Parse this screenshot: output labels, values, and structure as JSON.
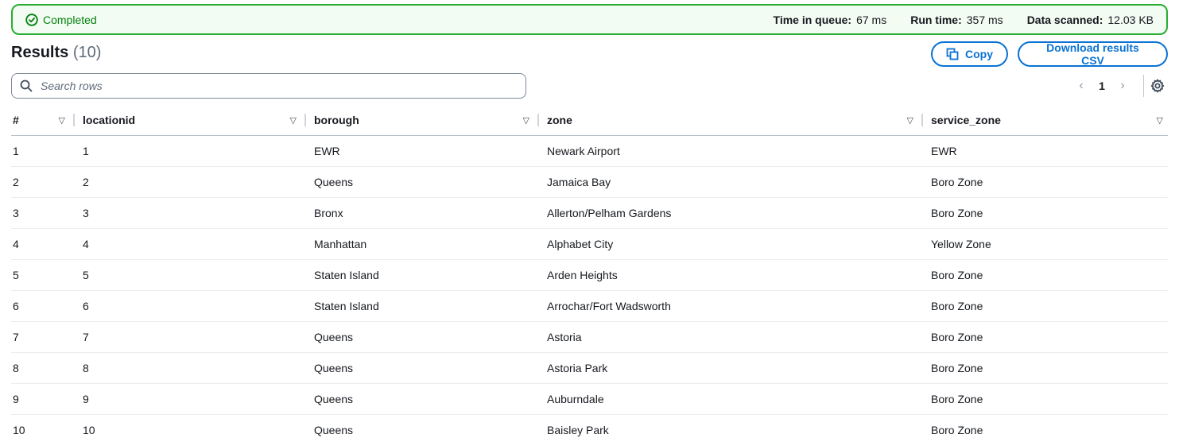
{
  "status": {
    "label": "Completed",
    "metrics": [
      {
        "name": "Time in queue:",
        "value": "67 ms"
      },
      {
        "name": "Run time:",
        "value": "357 ms"
      },
      {
        "name": "Data scanned:",
        "value": "12.03 KB"
      }
    ]
  },
  "results": {
    "title": "Results",
    "count": "(10)"
  },
  "actions": {
    "copy_label": "Copy",
    "download_label": "Download results CSV"
  },
  "search": {
    "placeholder": "Search rows",
    "value": ""
  },
  "pagination": {
    "prev": "‹",
    "page": "1",
    "next": "›"
  },
  "icons": {
    "status": "check-circle-icon",
    "copy": "copy-icon",
    "search": "search-icon",
    "sort": "sort-triangle-icon",
    "settings": "gear-icon"
  },
  "colors": {
    "success": "#037f0c",
    "success_border": "#29ad32",
    "accent": "#0972d3"
  },
  "table": {
    "columns": [
      "#",
      "locationid",
      "borough",
      "zone",
      "service_zone"
    ],
    "rows": [
      [
        "1",
        "1",
        "EWR",
        "Newark Airport",
        "EWR"
      ],
      [
        "2",
        "2",
        "Queens",
        "Jamaica Bay",
        "Boro Zone"
      ],
      [
        "3",
        "3",
        "Bronx",
        "Allerton/Pelham Gardens",
        "Boro Zone"
      ],
      [
        "4",
        "4",
        "Manhattan",
        "Alphabet City",
        "Yellow Zone"
      ],
      [
        "5",
        "5",
        "Staten Island",
        "Arden Heights",
        "Boro Zone"
      ],
      [
        "6",
        "6",
        "Staten Island",
        "Arrochar/Fort Wadsworth",
        "Boro Zone"
      ],
      [
        "7",
        "7",
        "Queens",
        "Astoria",
        "Boro Zone"
      ],
      [
        "8",
        "8",
        "Queens",
        "Astoria Park",
        "Boro Zone"
      ],
      [
        "9",
        "9",
        "Queens",
        "Auburndale",
        "Boro Zone"
      ],
      [
        "10",
        "10",
        "Queens",
        "Baisley Park",
        "Boro Zone"
      ]
    ]
  }
}
